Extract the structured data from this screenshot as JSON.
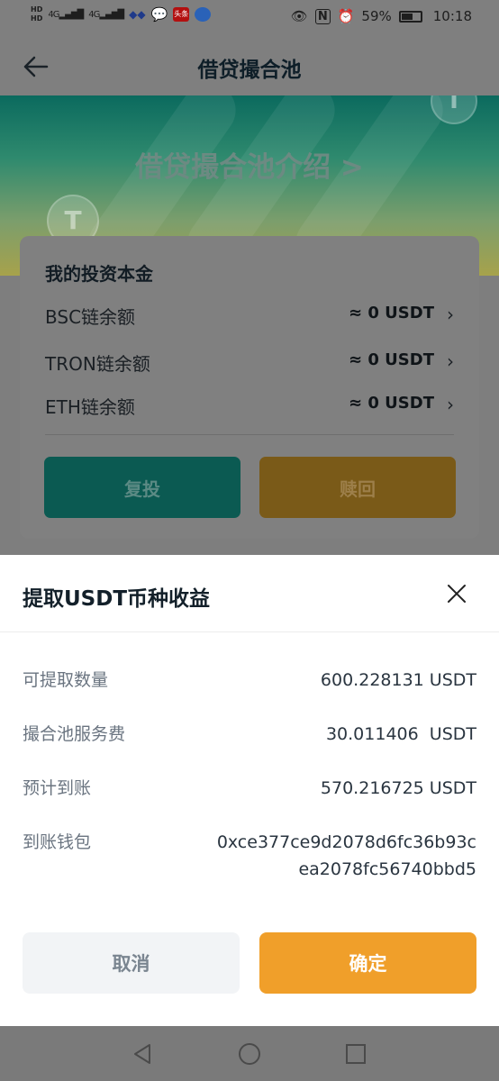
{
  "status_bar": {
    "network_1": "4G",
    "network_2": "4G",
    "app_badge": "头条",
    "battery_percent": "59%",
    "battery_level": 0.59,
    "time": "10:18",
    "icons": [
      "hd-icon",
      "signal-icon",
      "cloud-icon",
      "wechat-icon",
      "toutiao-icon",
      "browser-icon",
      "eye-icon",
      "nfc-icon",
      "alarm-icon",
      "battery-icon"
    ]
  },
  "nav": {
    "title": "借贷撮合池"
  },
  "banner": {
    "title": "借贷撮合池介绍 >",
    "coin_symbol": "T"
  },
  "investment": {
    "title": "我的投资本金",
    "rows": [
      {
        "label": "BSC链余额",
        "value": "≈ 0 USDT"
      },
      {
        "label": "TRON链余额",
        "value": "≈ 0 USDT"
      },
      {
        "label": "ETH链余额",
        "value": "≈ 0 USDT"
      }
    ],
    "reinvest_label": "复投",
    "redeem_label": "赎回"
  },
  "sheet": {
    "title": "提取USDT币种收益",
    "rows": [
      {
        "label": "可提取数量",
        "value": "600.228131 USDT"
      },
      {
        "label": "撮合池服务费",
        "value": "30.011406  USDT"
      },
      {
        "label": "预计到账",
        "value": "570.216725 USDT"
      },
      {
        "label": "到账钱包",
        "value_line1": "0xce377ce9d2078d6fc36b93c",
        "value_line2": "ea2078fc56740bbd5"
      }
    ],
    "cancel_label": "取消",
    "confirm_label": "确定"
  },
  "colors": {
    "accent_orange": "#f09f2a",
    "teal": "#0b5a52",
    "overlay": "#7f7f7f"
  }
}
